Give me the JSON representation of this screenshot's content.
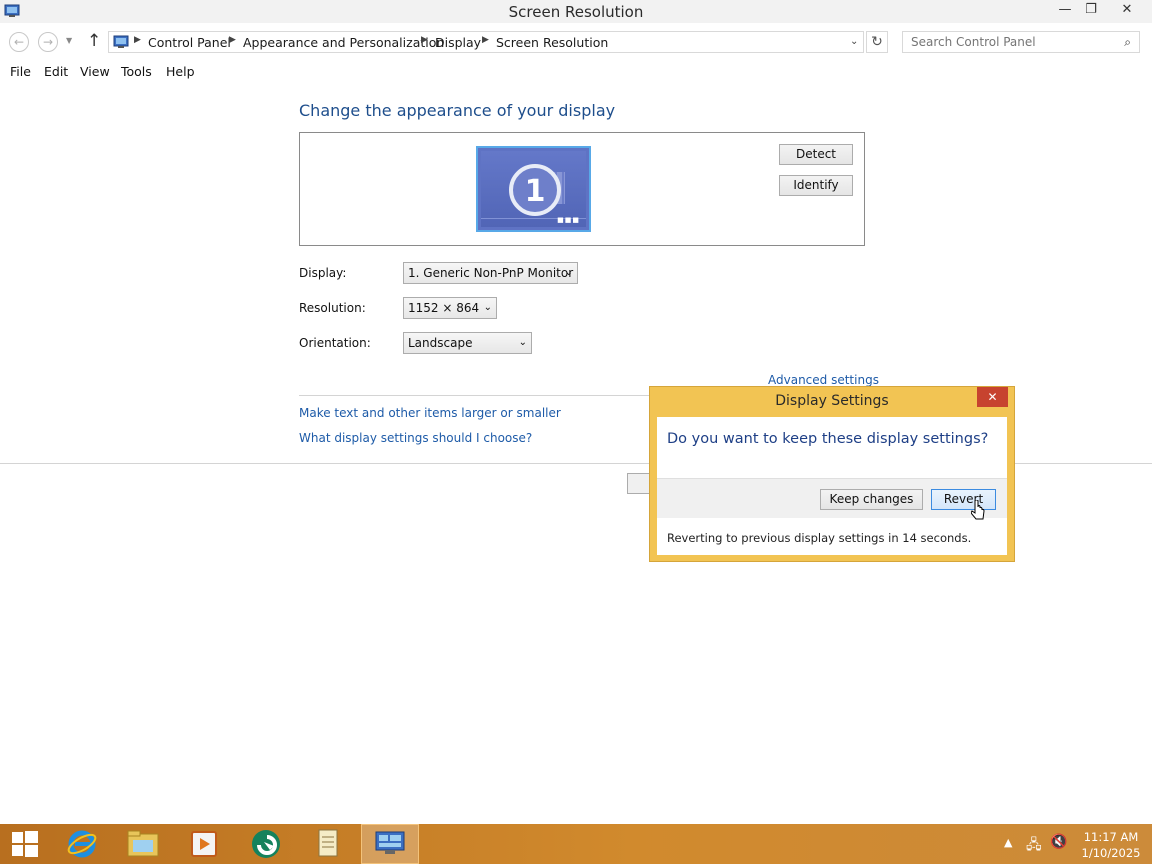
{
  "window": {
    "title": "Screen Resolution",
    "controls": {
      "minimize": "—",
      "maximize": "❐",
      "close": "✕"
    }
  },
  "navigation": {
    "back_icon": "back-arrow-icon",
    "forward_icon": "forward-arrow-icon",
    "up_icon": "up-arrow-icon",
    "breadcrumb": [
      "Control Panel",
      "Appearance and Personalization",
      "Display",
      "Screen Resolution"
    ],
    "search_placeholder": "Search Control Panel"
  },
  "menu": [
    "File",
    "Edit",
    "View",
    "Tools",
    "Help"
  ],
  "main": {
    "heading": "Change the appearance of your display",
    "monitor_number": "1",
    "detect_label": "Detect",
    "identify_label": "Identify",
    "display_label": "Display:",
    "display_value": "1. Generic Non-PnP Monitor",
    "resolution_label": "Resolution:",
    "resolution_value": "1152 × 864",
    "orientation_label": "Orientation:",
    "orientation_value": "Landscape",
    "advanced_link": "Advanced settings",
    "link_text_size": "Make text and other items larger or smaller",
    "link_help": "What display settings should I choose?"
  },
  "dialog": {
    "title": "Display Settings",
    "close_label": "✕",
    "question": "Do you want to keep these display settings?",
    "keep_label": "Keep changes",
    "revert_label": "Revert",
    "countdown_text": "Reverting to previous display settings in 14 seconds."
  },
  "taskbar": {
    "items": [
      "start-icon",
      "internet-explorer-icon",
      "file-explorer-icon",
      "media-player-icon",
      "browser-app-icon",
      "notepad-icon",
      "control-panel-icon"
    ],
    "active_item": "control-panel-icon",
    "time": "11:17 AM",
    "date": "1/10/2025"
  },
  "colors": {
    "heading": "#1e4e8c",
    "link": "#1e5ba8",
    "dialog_frame": "#f2c453",
    "taskbar": "#c98127"
  }
}
